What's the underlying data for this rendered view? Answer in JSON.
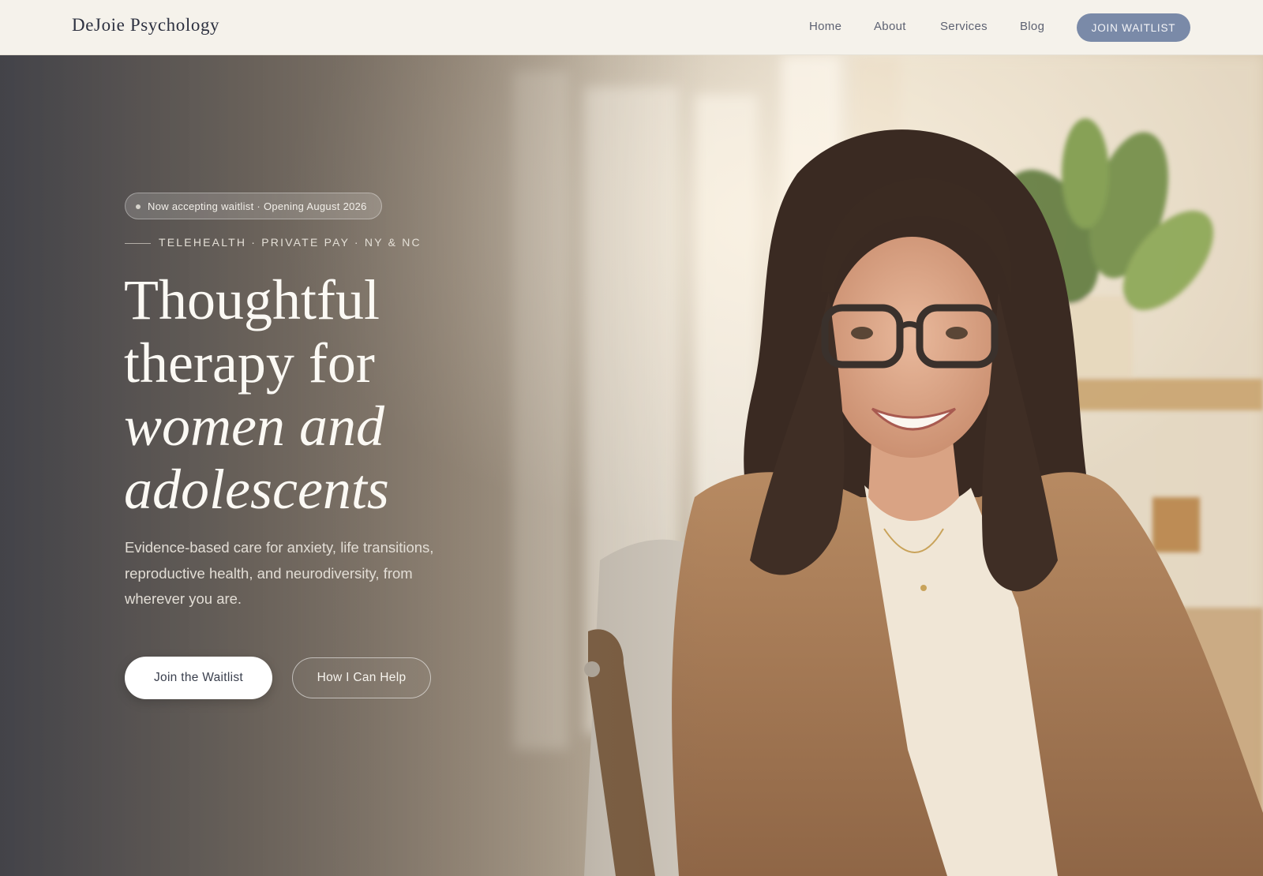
{
  "nav": {
    "logo": "DeJoie Psychology",
    "links": [
      "Home",
      "About",
      "Services",
      "Blog"
    ],
    "cta": "JOIN WAITLIST"
  },
  "hero": {
    "badge": "Now accepting waitlist · Opening August 2026",
    "eyebrow": "TELEHEALTH · PRIVATE PAY · NY & NC",
    "headline": [
      "Thoughtful",
      "therapy for",
      "women and",
      "adolescents"
    ],
    "subtext": "Evidence-based care for anxiety, life transitions, reproductive health, and neurodiversity, from wherever you are.",
    "primary_button": "Join the Waitlist",
    "secondary_button": "How I Can Help"
  },
  "colors": {
    "accent": "#7a8aa8",
    "background": "#f5f2eb",
    "text_dark": "#2d3140"
  }
}
